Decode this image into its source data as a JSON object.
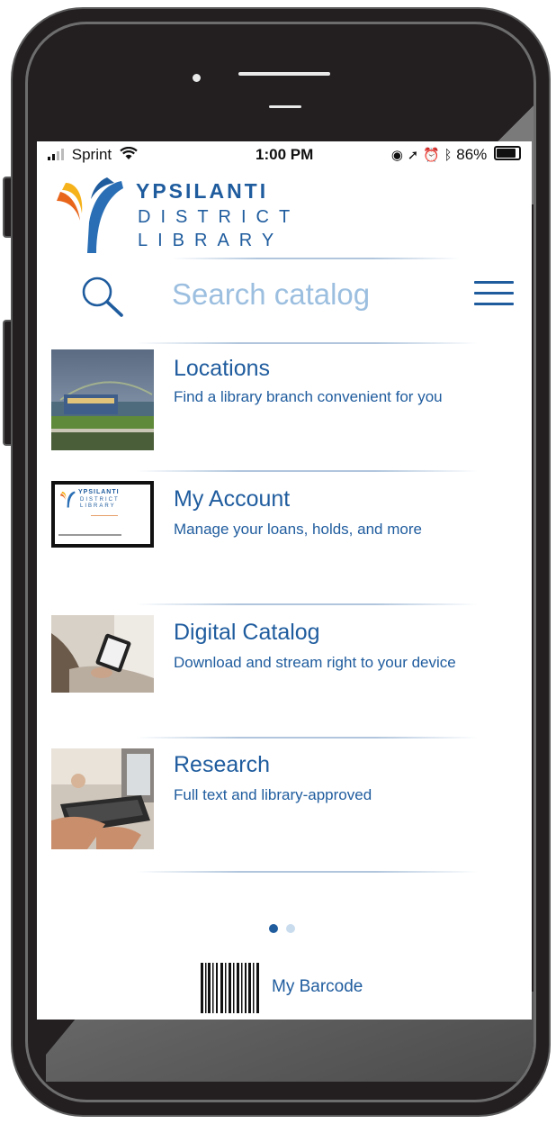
{
  "status_bar": {
    "carrier": "Sprint",
    "time": "1:00 PM",
    "battery": "86%",
    "battery_level": 0.86
  },
  "logo": {
    "line1": "YPSILANTI",
    "line2": "DISTRICT",
    "line3": "LIBRARY"
  },
  "search": {
    "placeholder": "Search catalog"
  },
  "menu_items": [
    {
      "title": "Locations",
      "description": "Find a library branch convenient for you",
      "icon": "library-building-photo"
    },
    {
      "title": "My Account",
      "description": "Manage your loans, holds, and more",
      "icon": "library-card-photo"
    },
    {
      "title": "Digital Catalog",
      "description": "Download and stream right to your device",
      "icon": "tablet-reading-photo"
    },
    {
      "title": "Research",
      "description": "Full text and library-approved",
      "icon": "keyboard-typing-photo"
    }
  ],
  "card_thumb": {
    "line1": "YPSILANTI",
    "line2": "DISTRICT",
    "line3": "LIBRARY"
  },
  "pagination": {
    "pages": 2,
    "active": 1
  },
  "barcode": {
    "label": "My Barcode"
  },
  "colors": {
    "brand_blue": "#1f5c9e",
    "placeholder_blue": "#9cbfe0",
    "logo_orange": "#e8661c",
    "logo_yellow": "#f6b21b",
    "logo_blue": "#2a6fb5"
  }
}
